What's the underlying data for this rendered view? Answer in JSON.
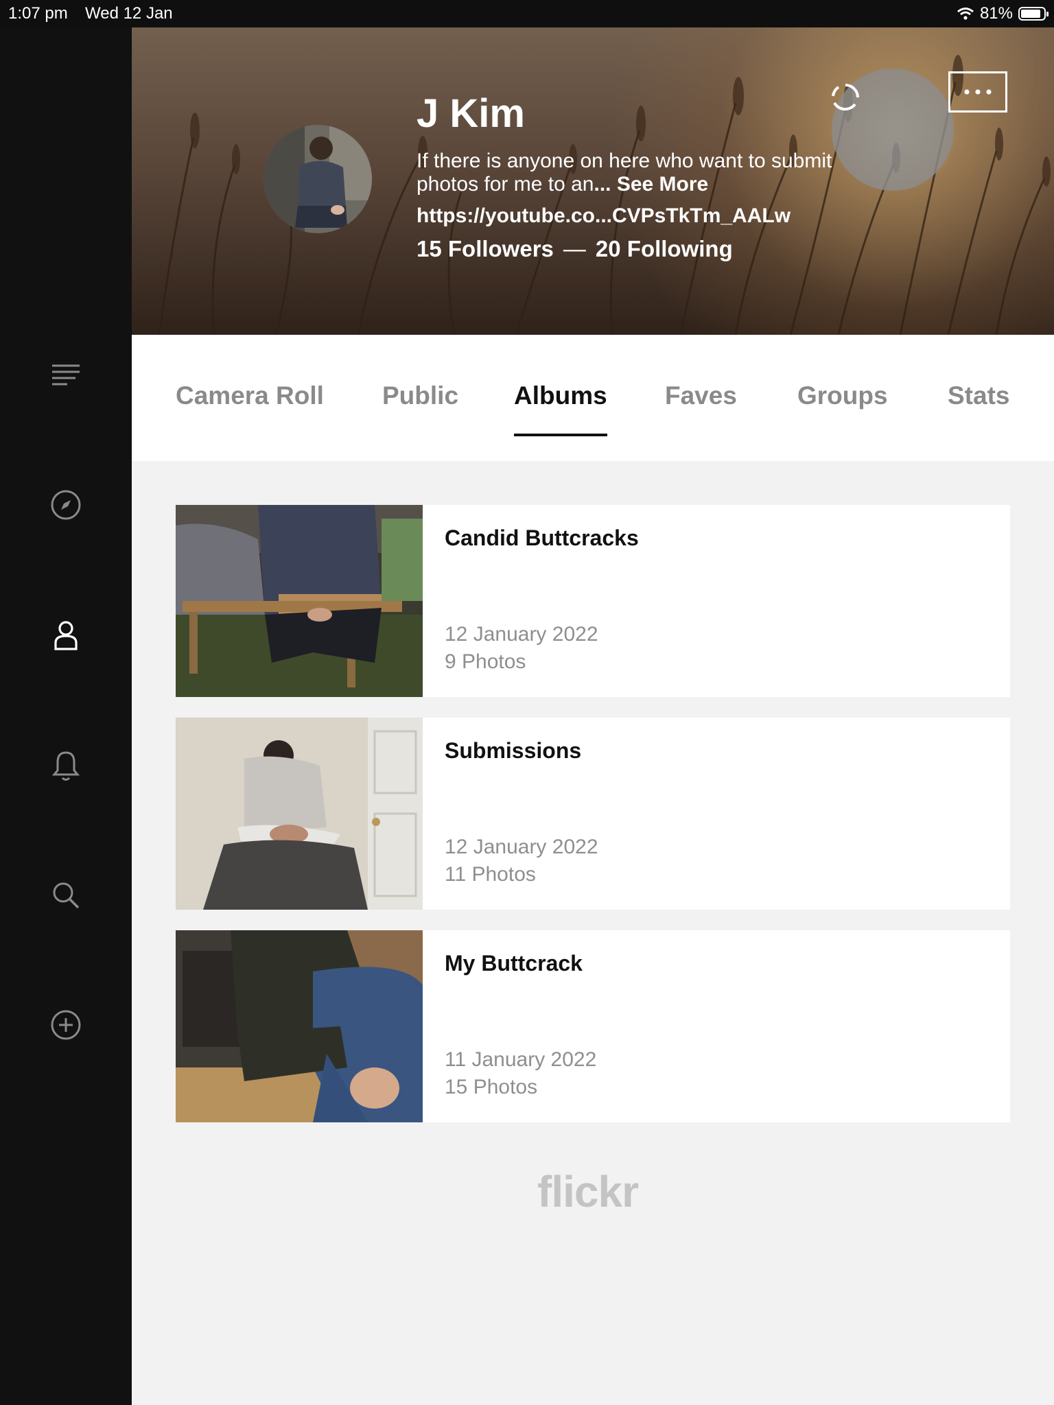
{
  "status_bar": {
    "time": "1:07 pm",
    "date": "Wed 12 Jan",
    "battery": "81%"
  },
  "sidebar": {
    "items": [
      {
        "icon": "menu-icon"
      },
      {
        "icon": "compass-icon"
      },
      {
        "icon": "profile-icon"
      },
      {
        "icon": "bell-icon"
      },
      {
        "icon": "search-icon"
      },
      {
        "icon": "add-circle-icon"
      }
    ]
  },
  "profile": {
    "name": "J Kim",
    "bio": "If there is anyone on here who want to submit photos for me to an",
    "see_more": "... See More",
    "link": "https://youtube.co...CVPsTkTm_AALw",
    "followers": "15 Followers",
    "separator": "—",
    "following": "20 Following"
  },
  "tabs": [
    {
      "label": "Camera Roll"
    },
    {
      "label": "Public"
    },
    {
      "label": "Albums"
    },
    {
      "label": "Faves"
    },
    {
      "label": "Groups"
    },
    {
      "label": "Stats"
    }
  ],
  "active_tab": "Albums",
  "albums": [
    {
      "title": "Candid Buttcracks",
      "date": "12 January 2022",
      "count": "9 Photos"
    },
    {
      "title": "Submissions",
      "date": "12 January 2022",
      "count": "11 Photos"
    },
    {
      "title": "My Buttcrack",
      "date": "11 January 2022",
      "count": "15 Photos"
    }
  ],
  "footer": {
    "logo": "flickr"
  }
}
